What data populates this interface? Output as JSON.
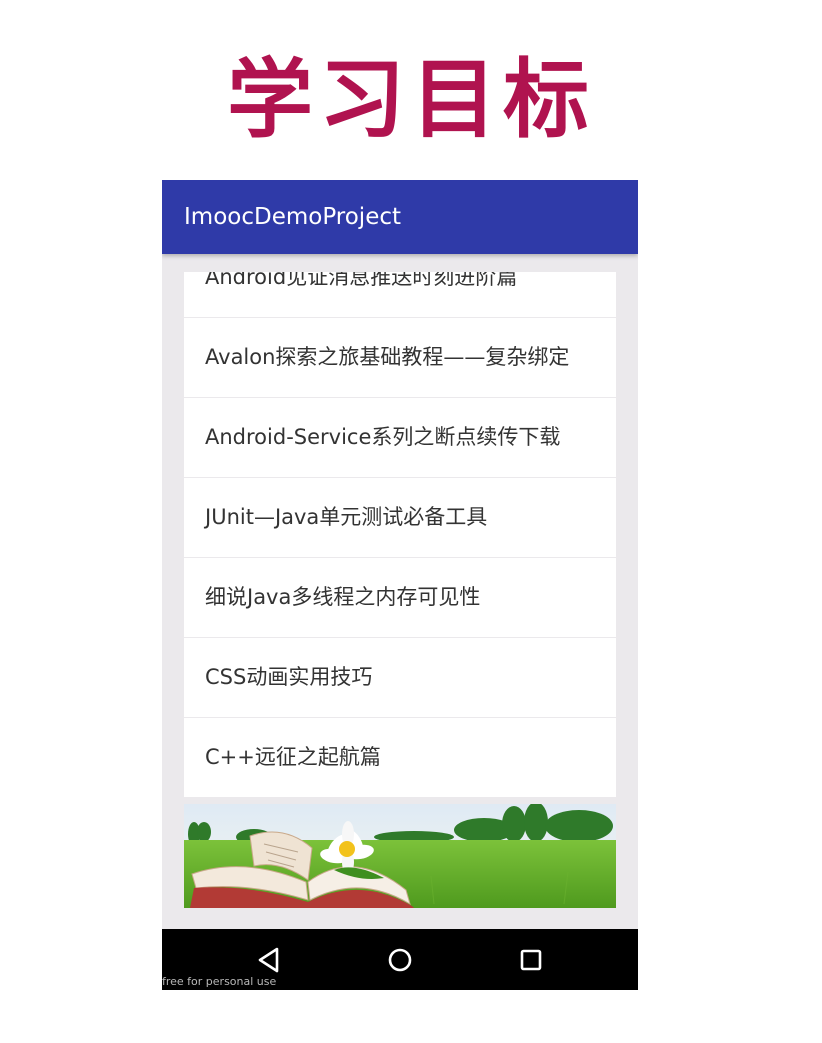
{
  "slide": {
    "title": "学习目标"
  },
  "app": {
    "title": "ImoocDemoProject"
  },
  "list": {
    "items": [
      "Android见证消息推送时刻进阶篇",
      "Avalon探索之旅基础教程——复杂绑定",
      "Android-Service系列之断点续传下载",
      "JUnit—Java单元测试必备工具",
      "细说Java多线程之内存可见性",
      "CSS动画实用技巧",
      "C++远征之起航篇"
    ]
  },
  "navbar": {
    "back_icon": "back-triangle-icon",
    "home_icon": "home-circle-icon",
    "recents_icon": "recents-square-icon"
  },
  "watermark": {
    "text": "free for personal use"
  },
  "colors": {
    "title": "#b0134f",
    "app_bar": "#2f3aa8",
    "background": "#ebe9ec",
    "nav_bar": "#000000"
  }
}
